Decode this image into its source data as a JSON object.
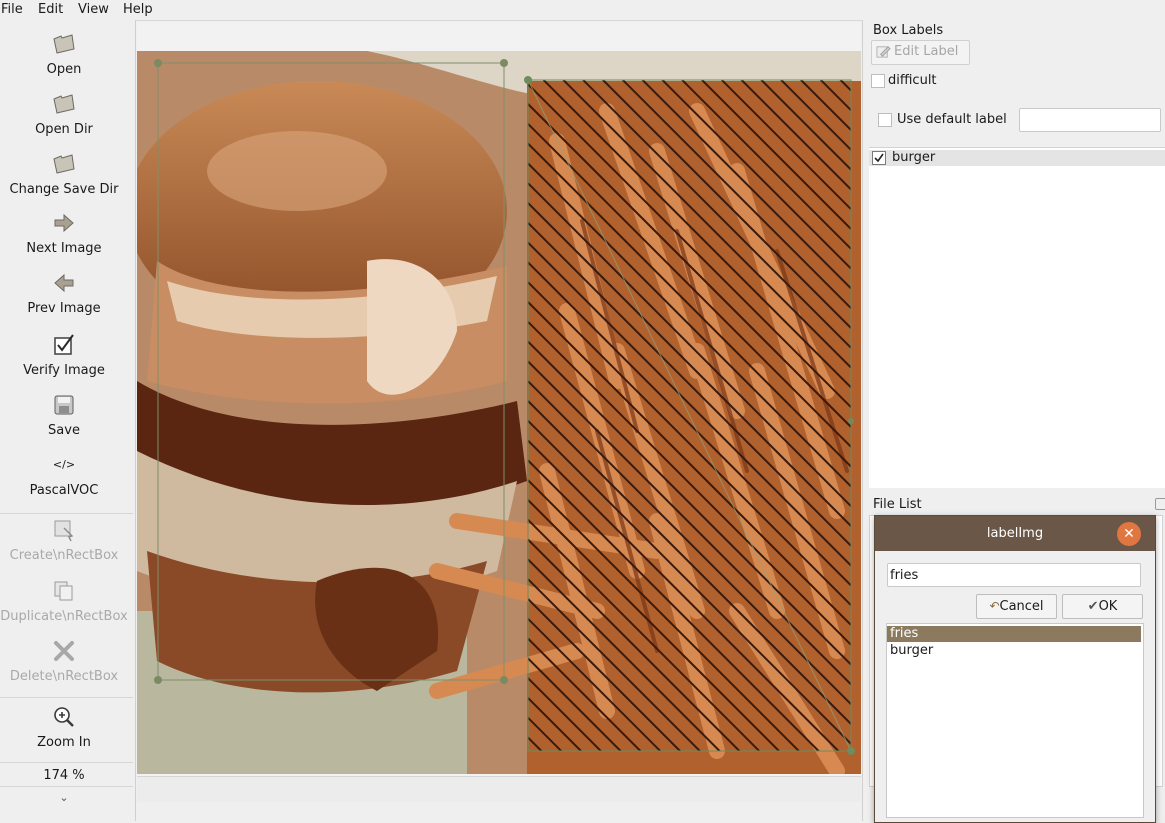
{
  "menu": [
    "File",
    "Edit",
    "View",
    "Help"
  ],
  "toolbar": {
    "open": "Open",
    "open_dir": "Open Dir",
    "change_save_dir": "Change Save Dir",
    "next_image": "Next Image",
    "prev_image": "Prev Image",
    "verify_image": "Verify Image",
    "save": "Save",
    "format_icon_text": "</>",
    "format": "PascalVOC",
    "create_rect": "Create\\nRectBox",
    "duplicate_rect": "Duplicate\\nRectBox",
    "delete_rect": "Delete\\nRectBox",
    "zoom_in": "Zoom In",
    "zoom_value": "174 %",
    "more": "⌄"
  },
  "dock": {
    "box_labels_title": "Box Labels",
    "edit_label": "Edit Label",
    "difficult": "difficult",
    "use_default_label": "Use default label",
    "default_label_value": "",
    "labels": [
      {
        "text": "burger",
        "checked": true
      }
    ],
    "file_list_title": "File List"
  },
  "dialog": {
    "title": "labelImg",
    "input_value": "fries",
    "cancel": "Cancel",
    "ok": "OK",
    "items": [
      "fries",
      "burger"
    ],
    "selected": "fries"
  },
  "colors": {
    "dialog_titlebar": "#6b5747",
    "close_button": "#e07640",
    "selection": "#8b7a5e",
    "box_line": "#6e8c5e"
  }
}
